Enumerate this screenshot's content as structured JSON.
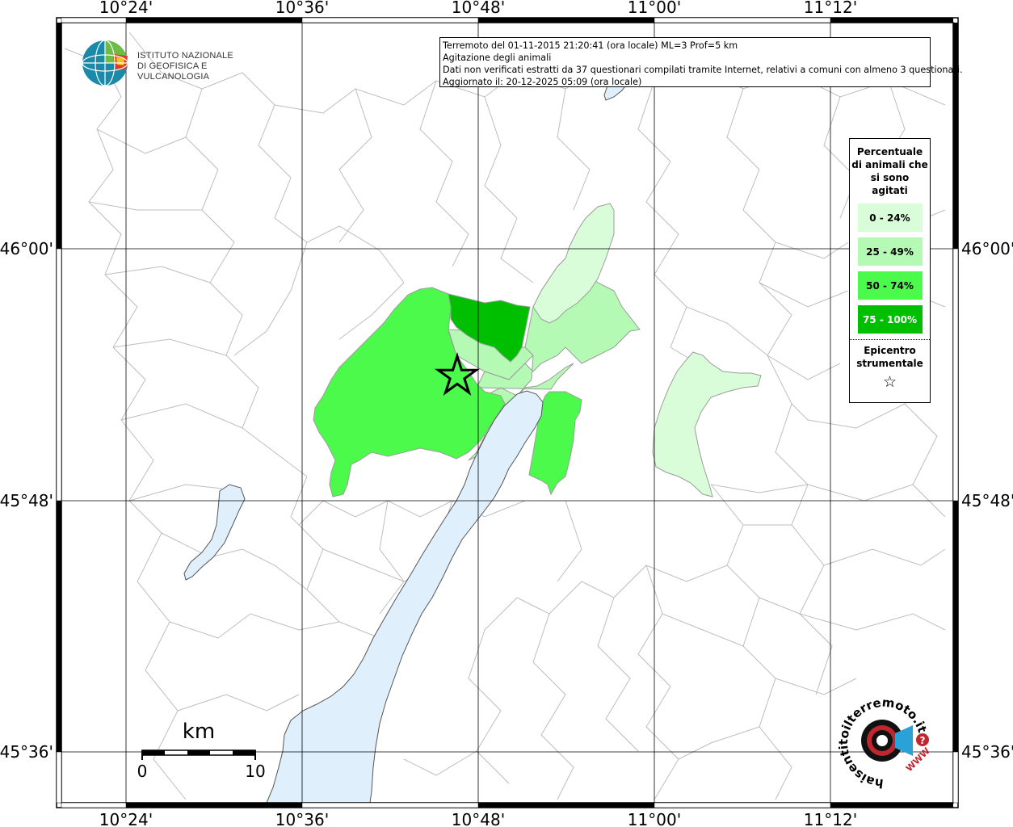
{
  "map": {
    "lon_ticks": [
      "10°24'",
      "10°36'",
      "10°48'",
      "11°00'",
      "11°12'"
    ],
    "lat_ticks": [
      "46°00'",
      "45°48'",
      "45°36'"
    ],
    "colors": {
      "water": "#dff0fc",
      "border": "#bdbdbd",
      "grid": "#000000",
      "class0": "#d9fcd9",
      "class1": "#b4fab4",
      "class2": "#4cfa4c",
      "class3": "#00bf00"
    }
  },
  "info": {
    "line1": "Terremoto del 01-11-2015 21:20:41 (ora locale) ML=3 Prof=5 km",
    "line2": "Agitazione degli animali",
    "line3": "Dati non verificati estratti da 37 questionari compilati tramite Internet, relativi a comuni con almeno 3 questionari.",
    "line4": "Aggiornato il: 20-12-2025 05:09 (ora locale)"
  },
  "legend": {
    "title": "Percentuale di animali che si sono agitati",
    "items": [
      {
        "label": "0 - 24%",
        "color": "#d9fcd9",
        "text_color": "#000000"
      },
      {
        "label": "25 - 49%",
        "color": "#b4fab4",
        "text_color": "#000000"
      },
      {
        "label": "50 - 74%",
        "color": "#4cfa4c",
        "text_color": "#000000"
      },
      {
        "label": "75 - 100%",
        "color": "#00bf00",
        "text_color": "#ffffff"
      }
    ],
    "epicenter_label": "Epicentro strumentale",
    "epicenter_symbol": "☆"
  },
  "logo": {
    "line1": "ISTITUTO NAZIONALE",
    "line2": "DI GEOFISICA E VULCANOLOGIA"
  },
  "scalebar": {
    "unit": "km",
    "start": "0",
    "end": "10"
  },
  "hst": {
    "text": "haisentitoilterremoto.it",
    "www": "WWW"
  }
}
